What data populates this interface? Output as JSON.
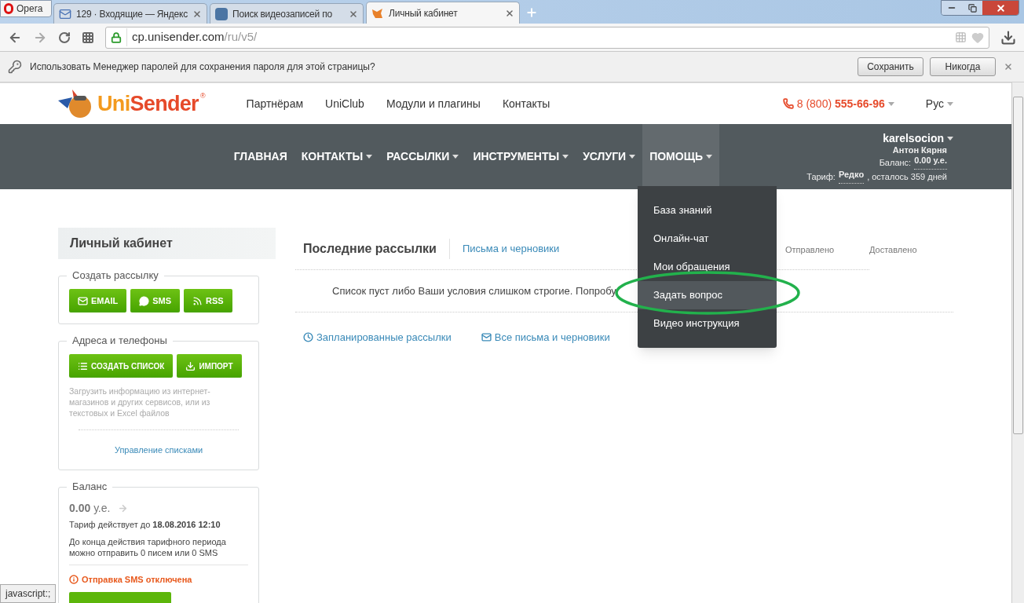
{
  "browser": {
    "menu_label": "Opera",
    "tabs": [
      {
        "title": "129 · Входящие — Яндекс",
        "kind": "mail",
        "selected": false
      },
      {
        "title": "Поиск видеозаписей по",
        "kind": "vk",
        "selected": false
      },
      {
        "title": "Личный кабинет",
        "kind": "fox",
        "selected": true
      }
    ],
    "address": {
      "host": "cp.unisender.com",
      "path": "/ru/v5/"
    },
    "password_bar": {
      "text": "Использовать Менеджер паролей для сохранения пароля для этой страницы?",
      "buttons": [
        "Сохранить",
        "Никогда"
      ]
    }
  },
  "header": {
    "logo_first": "Uni",
    "logo_second": "Sender",
    "logo_mark": "®",
    "links": [
      "Партнёрам",
      "UniClub",
      "Модули и плагины",
      "Контакты"
    ],
    "phone": "8 (800) **555-66-96**",
    "language": "Рус"
  },
  "nav": {
    "items": [
      {
        "label": "ГЛАВНАЯ",
        "has_caret": false,
        "selected": false
      },
      {
        "label": "КОНТАКТЫ",
        "has_caret": true,
        "selected": false
      },
      {
        "label": "РАССЫЛКИ",
        "has_caret": true,
        "selected": false
      },
      {
        "label": "ИНСТРУМЕНТЫ",
        "has_caret": true,
        "selected": false
      },
      {
        "label": "УСЛУГИ",
        "has_caret": true,
        "selected": false
      },
      {
        "label": "ПОМОЩЬ",
        "has_caret": true,
        "selected": true
      }
    ],
    "user": {
      "login": "karelsocion",
      "name": "Антон Кярня",
      "balance_label": "Баланс:",
      "balance": "0.00 у.е.",
      "tariff_label": "Тариф:",
      "tariff": "Редко",
      "tariff_rest": ", осталось 359 дней"
    }
  },
  "help_menu": {
    "items": [
      {
        "label": "База знаний",
        "selected": false
      },
      {
        "label": "Онлайн-чат",
        "selected": false
      },
      {
        "label": "Мои обращения",
        "selected": false
      },
      {
        "label": "Задать вопрос",
        "selected": true
      },
      {
        "label": "Видео инструкция",
        "selected": false
      }
    ]
  },
  "sidebar": {
    "title": "Личный кабинет",
    "create": {
      "legend": "Создать рассылку",
      "buttons": [
        {
          "label": "EMAIL",
          "kind": "mail"
        },
        {
          "label": "SMS",
          "kind": "chat"
        },
        {
          "label": "RSS",
          "kind": "rss"
        }
      ]
    },
    "contacts": {
      "legend": "Адреса и телефоны",
      "buttons": [
        {
          "label": "СОЗДАТЬ СПИСОК",
          "kind": "list"
        },
        {
          "label": "ИМПОРТ",
          "kind": "download"
        }
      ],
      "hint": "Загрузить информацию из интернет-магазинов и других сервисов, или из текстовых и Excel файлов",
      "link": "Управление списками"
    },
    "balance": {
      "legend": "Баланс",
      "amount": "**0.00** у.е.",
      "tariff": "Тариф действует до **18.08.2016 12:10**",
      "note": "До конца действия тарифного периода можно отправить 0 писем или 0 SMS",
      "warning": "Отправка SMS отключена"
    }
  },
  "main": {
    "title": "Последние рассылки",
    "tab_link": "Письма и черновики",
    "columns": [
      "Отправлено",
      "Доставлено"
    ],
    "empty_text": "Список пуст либо Ваши условия слишком строгие. Попробу",
    "links": [
      {
        "label": "Запланированные рассылки",
        "kind": "clock"
      },
      {
        "label": "Все письма и черновики",
        "kind": "mail"
      }
    ]
  },
  "status_bar": "javascript:;"
}
